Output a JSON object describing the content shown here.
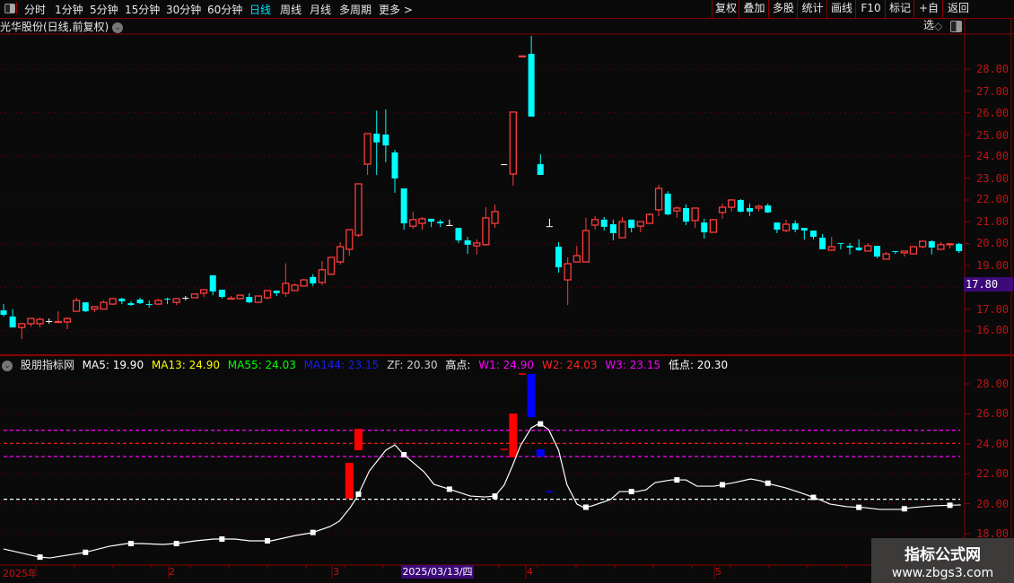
{
  "toolbar": {
    "periods": [
      "分时",
      "1分钟",
      "5分钟",
      "15分钟",
      "30分钟",
      "60分钟",
      "日线",
      "周线",
      "月线",
      "多周期",
      "更多 >"
    ],
    "active_period": "日线",
    "buttons": [
      "复权",
      "叠加",
      "多股",
      "统计",
      "画线",
      "F10",
      "标记",
      "+自选",
      "返回"
    ]
  },
  "chart_title": "光华股份(日线,前复权)",
  "main_axis": {
    "labels": [
      "28.00",
      "27.00",
      "26.00",
      "25.00",
      "24.00",
      "23.00",
      "22.00",
      "21.00",
      "20.00",
      "19.00",
      "17.00",
      "16.00"
    ],
    "crosshair_price": "17.80",
    "range": [
      16,
      28
    ]
  },
  "candles": [
    [
      16.94,
      17.23,
      16.66,
      16.74
    ],
    [
      16.66,
      17.0,
      16.16,
      16.16
    ],
    [
      16.16,
      16.37,
      15.63,
      16.33
    ],
    [
      16.33,
      16.57,
      16.2,
      16.57
    ],
    [
      16.33,
      16.62,
      16.16,
      16.53
    ],
    [
      16.45,
      16.57,
      16.33,
      16.45
    ],
    [
      16.41,
      16.9,
      16.37,
      16.43
    ],
    [
      16.41,
      16.62,
      16.08,
      16.57
    ],
    [
      16.9,
      17.52,
      16.9,
      17.4
    ],
    [
      17.31,
      17.31,
      16.86,
      16.9
    ],
    [
      17.0,
      17.15,
      16.86,
      17.11
    ],
    [
      17.0,
      17.4,
      17.0,
      17.31
    ],
    [
      17.23,
      17.5,
      17.2,
      17.48
    ],
    [
      17.48,
      17.52,
      17.23,
      17.36
    ],
    [
      17.27,
      17.36,
      17.15,
      17.19
    ],
    [
      17.44,
      17.52,
      17.23,
      17.27
    ],
    [
      17.23,
      17.4,
      17.07,
      17.19
    ],
    [
      17.23,
      17.48,
      17.19,
      17.4
    ],
    [
      17.48,
      17.52,
      17.23,
      17.44
    ],
    [
      17.31,
      17.48,
      17.19,
      17.48
    ],
    [
      17.52,
      17.6,
      17.4,
      17.52
    ],
    [
      17.52,
      17.73,
      17.52,
      17.69
    ],
    [
      17.73,
      17.9,
      17.56,
      17.89
    ],
    [
      18.55,
      18.55,
      17.64,
      17.81
    ],
    [
      17.89,
      17.89,
      17.48,
      17.56
    ],
    [
      17.48,
      17.6,
      17.44,
      17.5
    ],
    [
      17.48,
      17.64,
      17.44,
      17.64
    ],
    [
      17.56,
      17.73,
      17.27,
      17.31
    ],
    [
      17.31,
      17.6,
      17.27,
      17.6
    ],
    [
      17.52,
      17.85,
      17.44,
      17.85
    ],
    [
      17.85,
      17.85,
      17.6,
      17.73
    ],
    [
      17.73,
      19.1,
      17.56,
      18.18
    ],
    [
      17.85,
      18.18,
      17.85,
      18.1
    ],
    [
      18.06,
      18.38,
      18.06,
      18.34
    ],
    [
      18.47,
      18.6,
      18.06,
      18.18
    ],
    [
      18.22,
      19.2,
      18.1,
      18.8
    ],
    [
      18.6,
      19.4,
      18.55,
      19.37
    ],
    [
      19.16,
      20.07,
      19.04,
      19.86
    ],
    [
      19.74,
      20.64,
      19.45,
      20.64
    ],
    [
      20.39,
      22.74,
      20.3,
      22.74
    ],
    [
      23.64,
      25.04,
      23.15,
      25.04
    ],
    [
      25.04,
      26.1,
      23.15,
      24.64
    ],
    [
      25.0,
      26.15,
      23.73,
      24.5
    ],
    [
      24.18,
      24.3,
      22.33,
      22.99
    ],
    [
      22.53,
      22.53,
      20.64,
      20.93
    ],
    [
      20.8,
      21.47,
      20.68,
      21.1
    ],
    [
      20.93,
      21.22,
      20.64,
      21.14
    ],
    [
      21.14,
      21.14,
      20.76,
      21.01
    ],
    [
      21.01,
      21.1,
      20.76,
      20.93
    ],
    [
      20.85,
      21.1,
      20.85,
      20.85
    ],
    [
      20.72,
      20.72,
      20.03,
      20.15
    ],
    [
      20.15,
      20.31,
      19.53,
      19.95
    ],
    [
      19.9,
      20.2,
      19.5,
      20.03
    ],
    [
      19.95,
      21.67,
      19.9,
      21.18
    ],
    [
      20.93,
      21.79,
      20.72,
      21.47
    ],
    [
      23.64,
      23.64,
      23.64,
      23.64
    ],
    [
      23.19,
      26.03,
      22.66,
      26.03
    ],
    [
      28.58,
      28.6,
      28.58,
      28.6
    ],
    [
      28.7,
      29.52,
      25.82,
      25.82
    ],
    [
      23.64,
      24.1,
      23.15,
      23.15
    ],
    [
      20.8,
      21.14,
      20.8,
      20.8
    ],
    [
      19.86,
      20.07,
      18.67,
      18.92
    ],
    [
      18.34,
      19.37,
      17.19,
      19.08
    ],
    [
      19.16,
      19.9,
      19.16,
      19.45
    ],
    [
      19.16,
      21.18,
      19.16,
      20.6
    ],
    [
      20.85,
      21.26,
      20.64,
      21.1
    ],
    [
      21.1,
      21.22,
      20.6,
      20.77
    ],
    [
      20.89,
      21.1,
      20.15,
      20.48
    ],
    [
      20.27,
      21.22,
      20.27,
      21.01
    ],
    [
      21.1,
      21.1,
      20.52,
      20.72
    ],
    [
      20.8,
      21.01,
      20.52,
      21.01
    ],
    [
      20.93,
      21.4,
      20.93,
      21.34
    ],
    [
      21.55,
      22.7,
      21.26,
      22.53
    ],
    [
      22.29,
      22.4,
      21.3,
      21.34
    ],
    [
      21.5,
      21.71,
      21.18,
      21.63
    ],
    [
      21.63,
      21.8,
      20.85,
      21.01
    ],
    [
      21.06,
      21.63,
      20.72,
      21.63
    ],
    [
      20.97,
      21.14,
      20.23,
      20.52
    ],
    [
      20.52,
      21.1,
      20.52,
      21.1
    ],
    [
      21.43,
      21.84,
      21.14,
      21.67
    ],
    [
      21.67,
      22.04,
      21.47,
      22.0
    ],
    [
      22.0,
      22.04,
      21.43,
      21.47
    ],
    [
      21.63,
      21.84,
      21.26,
      21.47
    ],
    [
      21.63,
      21.8,
      21.47,
      21.71
    ],
    [
      21.75,
      21.84,
      21.4,
      21.43
    ],
    [
      20.97,
      20.97,
      20.48,
      20.64
    ],
    [
      20.6,
      21.1,
      20.52,
      20.89
    ],
    [
      20.93,
      21.06,
      20.52,
      20.64
    ],
    [
      20.72,
      20.72,
      20.19,
      20.6
    ],
    [
      20.6,
      20.6,
      20.19,
      20.31
    ],
    [
      20.27,
      20.44,
      19.74,
      19.74
    ],
    [
      19.7,
      20.31,
      19.66,
      19.86
    ],
    [
      20.03,
      20.03,
      19.74,
      19.99
    ],
    [
      19.9,
      20.03,
      19.5,
      19.82
    ],
    [
      19.82,
      20.2,
      19.66,
      19.7
    ],
    [
      19.66,
      20.03,
      19.66,
      19.9
    ],
    [
      19.9,
      19.9,
      19.33,
      19.41
    ],
    [
      19.29,
      19.62,
      19.29,
      19.53
    ],
    [
      19.66,
      19.66,
      19.53,
      19.62
    ],
    [
      19.58,
      19.66,
      19.41,
      19.66
    ],
    [
      19.53,
      19.9,
      19.53,
      19.86
    ],
    [
      19.86,
      20.11,
      19.78,
      20.11
    ],
    [
      20.11,
      20.15,
      19.5,
      19.82
    ],
    [
      19.74,
      20.07,
      19.74,
      19.95
    ],
    [
      19.95,
      20.03,
      19.78,
      19.99
    ],
    [
      19.99,
      20.03,
      19.58,
      19.66
    ]
  ],
  "colors": {
    "up": "#ff3b3b",
    "down": "#00ffff",
    "flat": "#ffffff",
    "axis": "#8b0000",
    "grid": "#7a0000"
  },
  "indicator": {
    "name": "股朋指标网",
    "values": [
      {
        "label": "MA5: 19.90",
        "color": "#ffffff"
      },
      {
        "label": "MA13: 24.90",
        "color": "#ffff00"
      },
      {
        "label": "MA55: 24.03",
        "color": "#00ff00"
      },
      {
        "label": "MA144: 23.15",
        "color": "#1a1aff"
      },
      {
        "label": "ZF: 20.30",
        "color": "#cfcfcf"
      },
      {
        "label": "高点:",
        "color": "#ffffff"
      },
      {
        "label": "W1: 24.90",
        "color": "#ff00ff"
      },
      {
        "label": "W2: 24.03",
        "color": "#ff2020"
      },
      {
        "label": "W3: 23.15",
        "color": "#ff00ff"
      },
      {
        "label": "低点: 20.30",
        "color": "#ffffff"
      }
    ],
    "axis_labels": [
      "28.00",
      "26.00",
      "24.00",
      "22.00",
      "20.00",
      "18.00"
    ],
    "range": [
      18,
      28
    ],
    "hlines": [
      {
        "value": 24.9,
        "color": "#ff00ff"
      },
      {
        "value": 24.03,
        "color": "#ff2020"
      },
      {
        "value": 23.15,
        "color": "#ff00ff"
      },
      {
        "value": 20.3,
        "color": "#ffffff"
      }
    ],
    "line": [
      [
        0,
        16.98
      ],
      [
        3.9,
        16.44
      ],
      [
        5.1,
        16.38
      ],
      [
        6.3,
        16.5
      ],
      [
        8.9,
        16.74
      ],
      [
        11.6,
        17.16
      ],
      [
        13.6,
        17.34
      ],
      [
        15.1,
        17.34
      ],
      [
        17.5,
        17.28
      ],
      [
        19,
        17.34
      ],
      [
        21.1,
        17.52
      ],
      [
        23.1,
        17.64
      ],
      [
        25.4,
        17.64
      ],
      [
        27.1,
        17.52
      ],
      [
        29.4,
        17.52
      ],
      [
        32.1,
        17.88
      ],
      [
        33.9,
        18.06
      ],
      [
        35.9,
        18.48
      ],
      [
        36.9,
        18.84
      ],
      [
        38.1,
        19.74
      ],
      [
        38.9,
        20.51
      ],
      [
        40.2,
        22.19
      ],
      [
        42,
        23.57
      ],
      [
        43,
        23.93
      ],
      [
        44,
        23.27
      ],
      [
        46.2,
        22.13
      ],
      [
        47.3,
        21.29
      ],
      [
        48.9,
        20.99
      ],
      [
        51.3,
        20.51
      ],
      [
        52.9,
        20.45
      ],
      [
        54,
        20.51
      ],
      [
        55,
        21.23
      ],
      [
        55.9,
        22.49
      ],
      [
        56.8,
        23.87
      ],
      [
        58,
        25.07
      ],
      [
        58.9,
        25.37
      ],
      [
        59.9,
        24.95
      ],
      [
        61,
        23.57
      ],
      [
        61.9,
        21.29
      ],
      [
        63,
        19.98
      ],
      [
        63.8,
        19.74
      ],
      [
        64.7,
        19.86
      ],
      [
        66.7,
        20.28
      ],
      [
        67.7,
        20.81
      ],
      [
        69.6,
        20.81
      ],
      [
        70.6,
        20.93
      ],
      [
        71.6,
        21.41
      ],
      [
        73.4,
        21.59
      ],
      [
        75,
        21.59
      ],
      [
        76.2,
        21.17
      ],
      [
        78.1,
        21.17
      ],
      [
        80.3,
        21.41
      ],
      [
        82.1,
        21.65
      ],
      [
        83.2,
        21.53
      ],
      [
        84.4,
        21.29
      ],
      [
        86,
        21.05
      ],
      [
        87.8,
        20.69
      ],
      [
        89.9,
        20.22
      ],
      [
        90.8,
        19.98
      ],
      [
        92.7,
        19.8
      ],
      [
        94.6,
        19.74
      ],
      [
        96.3,
        19.62
      ],
      [
        98.6,
        19.62
      ],
      [
        99.8,
        19.74
      ],
      [
        102.2,
        19.86
      ],
      [
        105.2,
        19.92
      ]
    ],
    "bars": [
      {
        "index": 38,
        "from": 20.33,
        "to": 22.73,
        "color": "#ff0000"
      },
      {
        "index": 39,
        "from": 23.57,
        "to": 25.0,
        "color": "#ff0000"
      },
      {
        "index": 56,
        "from": 23.09,
        "to": 26.02,
        "color": "#ff0000"
      },
      {
        "index": 58,
        "from": 25.78,
        "to": 28.66,
        "color": "#0000ff"
      },
      {
        "index": 59,
        "from": 23.15,
        "to": 23.63,
        "color": "#0000ff"
      }
    ],
    "ticks": [
      {
        "index": 55,
        "value": 23.63,
        "color": "#ff0000"
      },
      {
        "index": 57,
        "value": 28.66,
        "color": "#ff0000"
      },
      {
        "index": 60,
        "value": 20.81,
        "color": "#0000ff"
      }
    ]
  },
  "x_axis": {
    "labels": [
      "2025年",
      "2",
      "3",
      "4",
      "5"
    ],
    "crosshair_date": "2025/03/13/四"
  },
  "watermark": {
    "title": "指标公式网",
    "url": "www.zbgs3.com"
  }
}
